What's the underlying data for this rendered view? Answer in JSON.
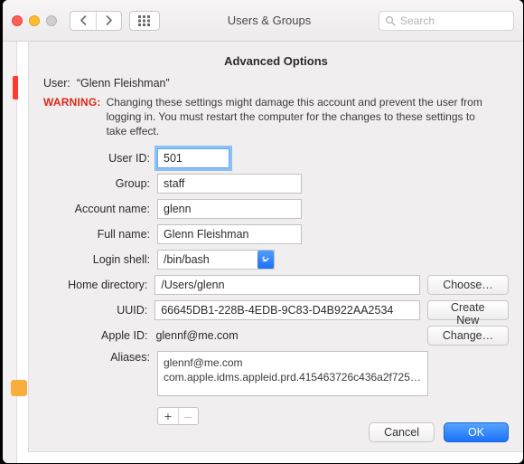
{
  "window": {
    "title": "Users & Groups",
    "search_placeholder": "Search"
  },
  "sheet": {
    "heading": "Advanced Options",
    "user_prefix": "User:",
    "user_name": "“Glenn Fleishman”",
    "warning_label": "WARNING:",
    "warning_text": "Changing these settings might damage this account and prevent the user from logging in. You must restart the computer for the changes to these settings to take effect."
  },
  "labels": {
    "user_id": "User ID:",
    "group": "Group:",
    "account_name": "Account name:",
    "full_name": "Full name:",
    "login_shell": "Login shell:",
    "home_dir": "Home directory:",
    "uuid": "UUID:",
    "apple_id": "Apple ID:",
    "aliases": "Aliases:"
  },
  "values": {
    "user_id": "501",
    "group": "staff",
    "account_name": "glenn",
    "full_name": "Glenn Fleishman",
    "login_shell": "/bin/bash",
    "home_dir": "/Users/glenn",
    "uuid": "66645DB1-228B-4EDB-9C83-D4B922AA2534",
    "apple_id": "glennf@me.com",
    "aliases": [
      "glennf@me.com",
      "com.apple.idms.appleid.prd.415463726c436a2f7250…"
    ]
  },
  "buttons": {
    "choose": "Choose…",
    "create_new": "Create New",
    "change": "Change…",
    "cancel": "Cancel",
    "ok": "OK",
    "plus": "+",
    "minus": "–"
  }
}
